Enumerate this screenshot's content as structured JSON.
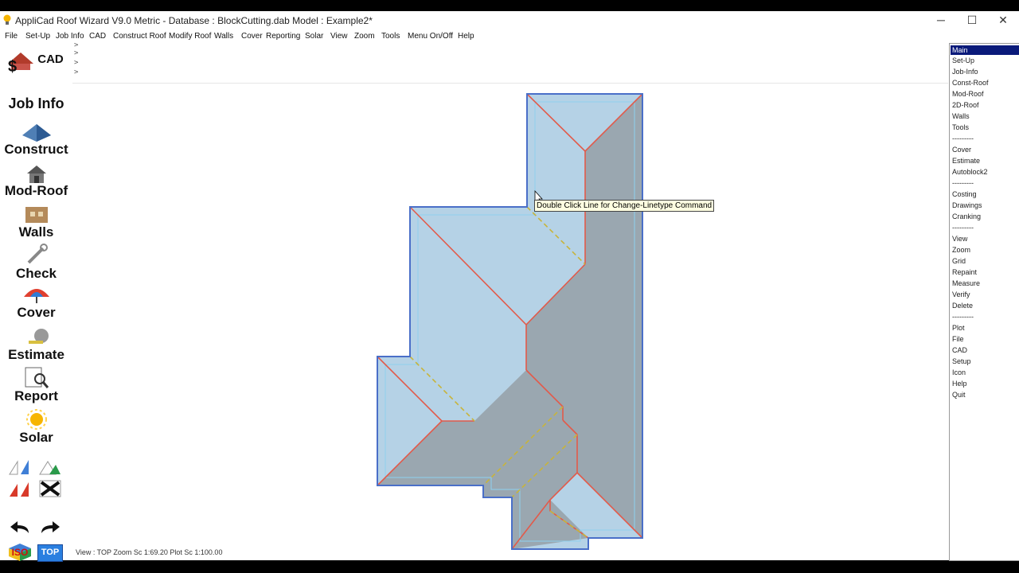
{
  "window": {
    "title": "AppliCad Roof Wizard V9.0 Metric - Database : BlockCutting.dab   Model : Example2*",
    "minimize": "─",
    "maximize": "☐",
    "close": "✕"
  },
  "menu": [
    "File",
    "Set-Up",
    "Job Info",
    "CAD",
    "Construct Roof",
    "Modify Roof",
    "Walls",
    "Cover",
    "Reporting",
    "Solar",
    "View",
    "Zoom",
    "Tools",
    "Menu On/Off",
    "Help"
  ],
  "left_toolbar": {
    "cad": "CAD",
    "job_info": "Job Info",
    "construct": "Construct",
    "mod_roof": "Mod-Roof",
    "walls": "Walls",
    "check": "Check",
    "cover": "Cover",
    "estimate": "Estimate",
    "report": "Report",
    "solar": "Solar",
    "iso": "ISO",
    "top": "TOP"
  },
  "command_lines": [
    ">",
    ">",
    ">",
    ">"
  ],
  "tooltip": "Double Click Line for Change-Linetype Command",
  "status": "View : TOP  Zoom Sc 1:69.20  Plot Sc 1:100.00",
  "right_menu": [
    "Main",
    "Set-Up",
    "Job-Info",
    "Const-Roof",
    "Mod-Roof",
    "2D-Roof",
    "Walls",
    "Tools",
    "---------",
    "Cover",
    "Estimate",
    "Autoblock2",
    "---------",
    "Costing",
    "Drawings",
    "Cranking",
    "---------",
    "View",
    "Zoom",
    "Grid",
    "Repaint",
    "Measure",
    "Verify",
    "Delete",
    "---------",
    "Plot",
    "File",
    "CAD",
    "Setup",
    "Icon",
    "Help",
    "Quit"
  ],
  "right_menu_active": "Main",
  "colors": {
    "roof_light": "#b5d2e6",
    "roof_dark": "#9aa7b0",
    "outline": "#4a6fc8",
    "hip_line": "#e25a4a",
    "valley_line": "#c8b43a",
    "inner_line": "#8fd0ef"
  }
}
